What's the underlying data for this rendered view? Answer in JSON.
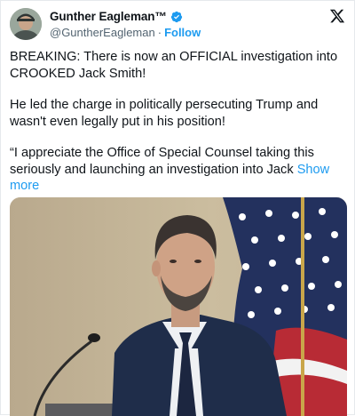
{
  "tweet": {
    "display_name": "Gunther Eagleman™",
    "handle": "@GuntherEagleman",
    "separator": "·",
    "follow_label": "Follow",
    "paragraphs": [
      "BREAKING: There is now an OFFICIAL investigation into CROOKED Jack Smith!",
      "He led the charge in politically persecuting Trump and wasn't even legally put in his position!"
    ],
    "quote_text": "“I appreciate the Office of Special Counsel taking this seriously and launching an investigation into Jack",
    "show_more_label": "Show more"
  },
  "icons": {
    "verified": "verified-badge-icon",
    "platform": "x-logo-icon"
  },
  "colors": {
    "accent": "#1d9bf0",
    "text": "#0f1419",
    "secondary_text": "#536471"
  }
}
